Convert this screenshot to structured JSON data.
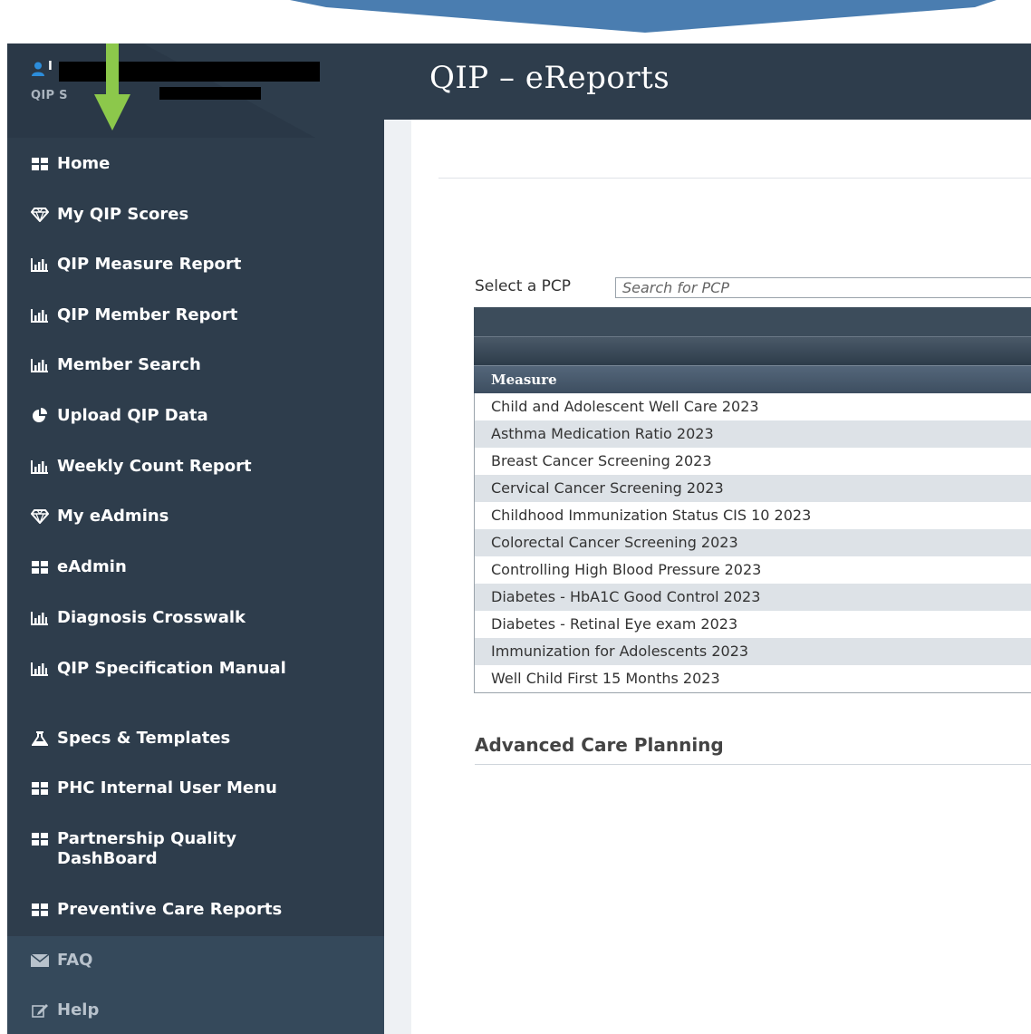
{
  "colors": {
    "sidebar": "#2e3d4c",
    "header": "#2e3d4c",
    "arrow": "#8cc84b",
    "banner": "#4a7db0"
  },
  "user": {
    "name_prefix": "I",
    "org": "QIP S"
  },
  "sidebar": {
    "items": [
      {
        "label": "Home",
        "icon": "grid-icon"
      },
      {
        "label": "My QIP Scores",
        "icon": "diamond-icon"
      },
      {
        "label": "QIP Measure Report",
        "icon": "bar-chart-icon"
      },
      {
        "label": "QIP Member Report",
        "icon": "bar-chart-icon"
      },
      {
        "label": "Member Search",
        "icon": "bar-chart-icon"
      },
      {
        "label": "Upload QIP Data",
        "icon": "pie-chart-icon"
      },
      {
        "label": "Weekly Count Report",
        "icon": "bar-chart-icon"
      },
      {
        "label": "My eAdmins",
        "icon": "diamond-icon"
      },
      {
        "label": "eAdmin",
        "icon": "grid-icon"
      },
      {
        "label": "Diagnosis Crosswalk",
        "icon": "bar-chart-icon"
      },
      {
        "label": "QIP Specification Manual",
        "icon": "bar-chart-icon"
      },
      {
        "label": "Specs & Templates",
        "icon": "flask-icon"
      },
      {
        "label": "PHC Internal User Menu",
        "icon": "grid-icon"
      },
      {
        "label": "Partnership Quality DashBoard",
        "icon": "grid-icon"
      },
      {
        "label": "Preventive Care Reports",
        "icon": "grid-icon"
      }
    ],
    "footer_items": [
      {
        "label": "FAQ",
        "icon": "envelope-icon"
      },
      {
        "label": "Help",
        "icon": "edit-icon"
      }
    ]
  },
  "header": {
    "title": "QIP – eReports"
  },
  "pcp": {
    "label": "Select a PCP",
    "placeholder": "Search for PCP"
  },
  "table": {
    "column": "Measure",
    "rows": [
      "Child and Adolescent Well Care 2023",
      "Asthma Medication Ratio 2023",
      "Breast Cancer Screening 2023",
      "Cervical Cancer Screening 2023",
      "Childhood Immunization Status CIS 10 2023",
      "Colorectal Cancer Screening 2023",
      "Controlling High Blood Pressure 2023",
      "Diabetes - HbA1C Good Control 2023",
      "Diabetes - Retinal Eye exam 2023",
      "Immunization for Adolescents 2023",
      "Well Child First 15 Months 2023"
    ]
  },
  "section": {
    "title": "Advanced Care Planning"
  }
}
